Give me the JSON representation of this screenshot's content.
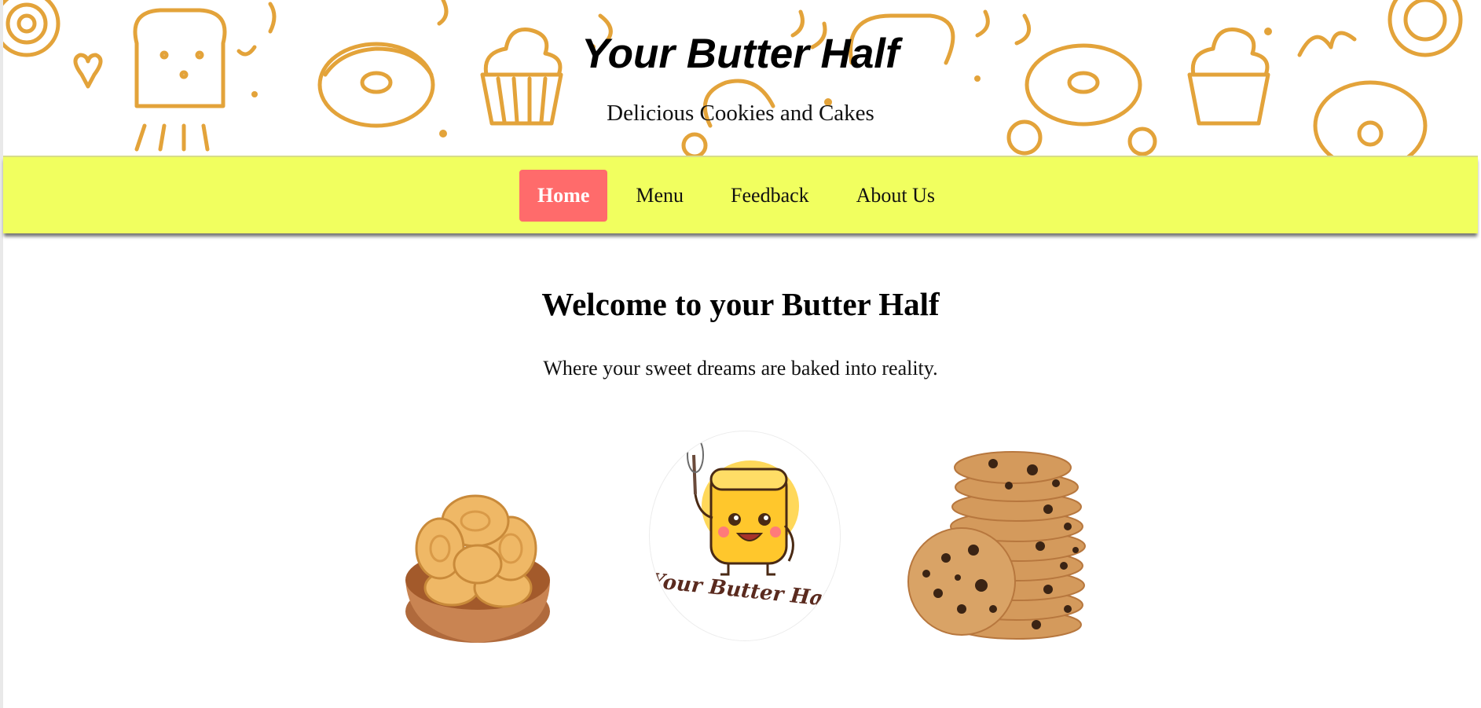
{
  "header": {
    "title": "Your Butter Half",
    "subtitle": "Delicious Cookies and Cakes"
  },
  "nav": {
    "items": [
      {
        "label": "Home",
        "active": true
      },
      {
        "label": "Menu",
        "active": false
      },
      {
        "label": "Feedback",
        "active": false
      },
      {
        "label": "About Us",
        "active": false
      }
    ]
  },
  "main": {
    "heading": "Welcome to your Butter Half",
    "tagline": "Where your sweet dreams are baked into reality.",
    "images": [
      {
        "name": "butter-cookies-bowl-image"
      },
      {
        "name": "logo-image",
        "text": "Your Butter Half"
      },
      {
        "name": "chocolate-chip-cookies-image"
      }
    ]
  },
  "colors": {
    "nav_bg": "#f1ff5f",
    "active_tab": "#ff6b6b",
    "doodle": "#e3a33a"
  }
}
